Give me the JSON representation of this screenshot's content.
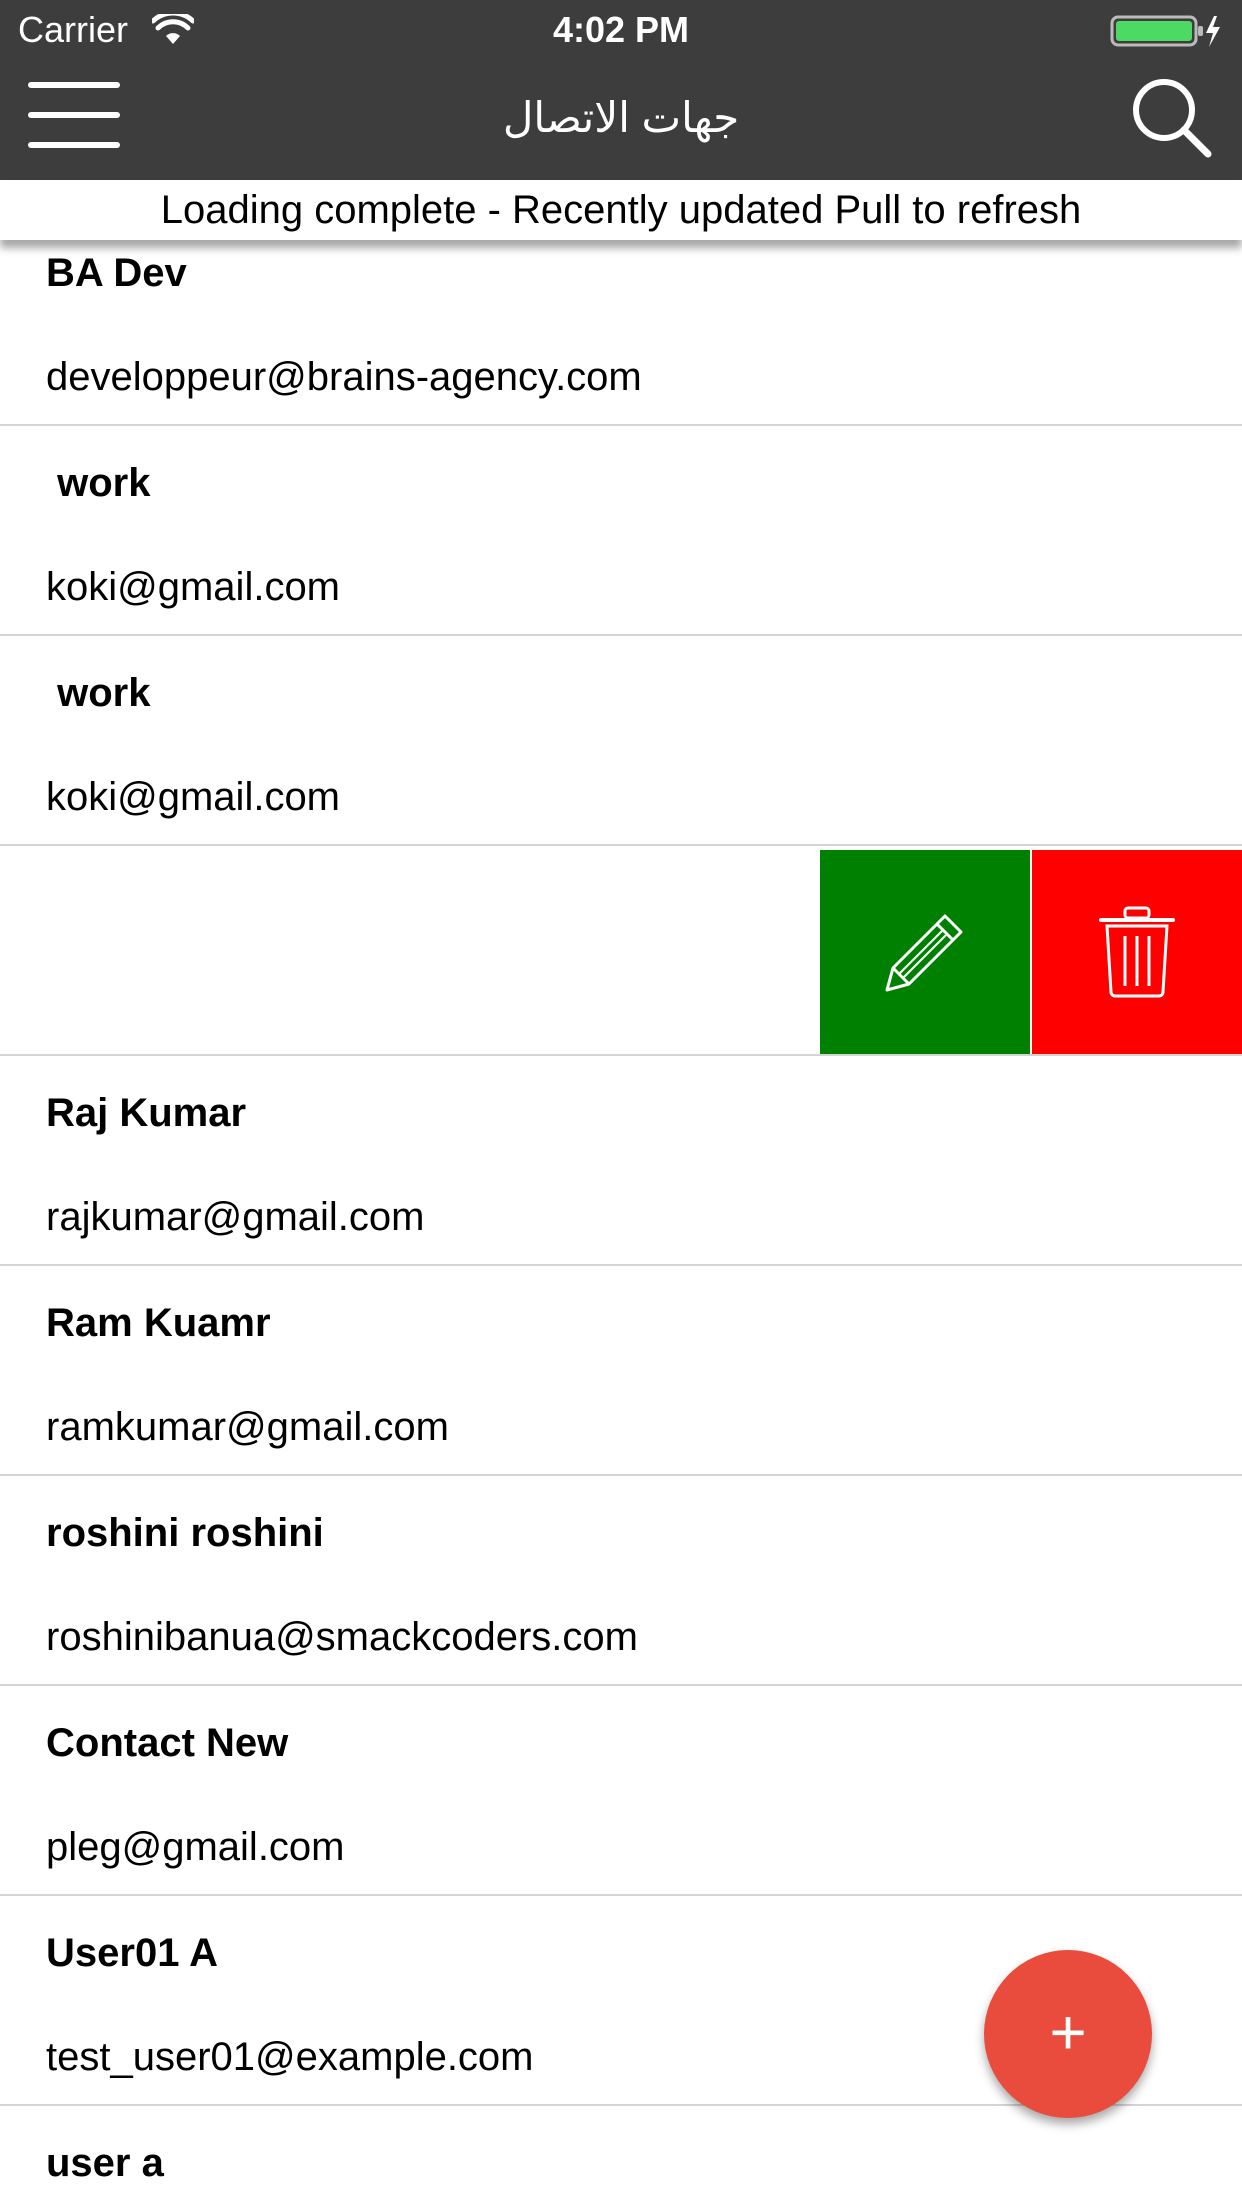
{
  "status_bar": {
    "carrier": "Carrier",
    "time": "4:02 PM",
    "battery_color": "#4cd964"
  },
  "nav_bar": {
    "title": "جهات الاتصال",
    "background": "#3d3d3d"
  },
  "refresh_banner": {
    "text": "Loading complete - Recently updated Pull to refresh"
  },
  "contacts": [
    {
      "name": "BA Dev",
      "email": "developpeur@brains-agency.com"
    },
    {
      "name": " work",
      "email": "koki@gmail.com"
    },
    {
      "name": " work",
      "email": "koki@gmail.com"
    },
    {
      "name": "",
      "email": "",
      "swiped": true
    },
    {
      "name": "Raj Kumar",
      "email": "rajkumar@gmail.com"
    },
    {
      "name": "Ram Kuamr",
      "email": "ramkumar@gmail.com"
    },
    {
      "name": "roshini roshini",
      "email": "roshinibanua@smackcoders.com"
    },
    {
      "name": "Contact New",
      "email": "pleg@gmail.com"
    },
    {
      "name": "User01 A",
      "email": "test_user01@example.com"
    },
    {
      "name": "user a",
      "email": ""
    }
  ],
  "swipe_actions": {
    "edit_icon": "pencil-icon",
    "edit_color": "#008000",
    "delete_icon": "trash-icon",
    "delete_color": "#ff0000"
  },
  "fab": {
    "label": "+",
    "color": "#e94b3c"
  }
}
